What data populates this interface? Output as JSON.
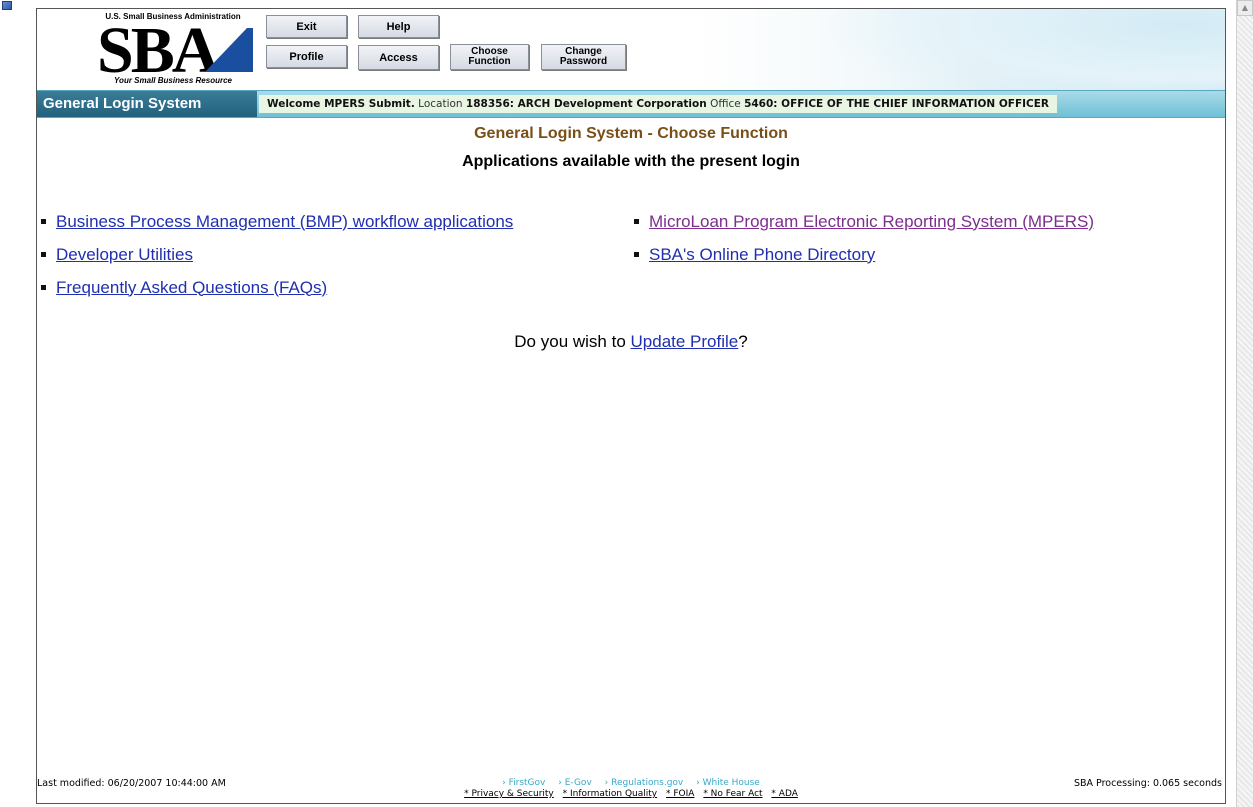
{
  "header": {
    "logo_top": "U.S. Small Business Administration",
    "logo_text": "SBA",
    "logo_tagline": "Your Small Business Resource",
    "buttons": {
      "exit": "Exit",
      "help": "Help",
      "profile": "Profile",
      "access": "Access",
      "choose_function_1": "Choose",
      "choose_function_2": "Function",
      "change_password_1": "Change",
      "change_password_2": "Password"
    }
  },
  "infobar": {
    "system_name": "General Login System",
    "welcome_label": "Welcome MPERS Submit.",
    "location_label": "Location",
    "location_value": "188356: ARCH Development Corporation",
    "office_label": "Office",
    "office_value": "5460: OFFICE OF THE CHIEF INFORMATION OFFICER"
  },
  "main": {
    "title": "General Login System - Choose Function",
    "subtitle": "Applications available with the present login",
    "apps_left": [
      "Business Process Management (BMP) workflow applications",
      "Developer Utilities",
      "Frequently Asked Questions (FAQs)"
    ],
    "apps_right": [
      "MicroLoan Program Electronic Reporting System (MPERS)",
      "SBA's Online Phone Directory"
    ],
    "update_prefix": "Do you wish to ",
    "update_link": "Update Profile",
    "update_suffix": "?"
  },
  "footer": {
    "last_modified": "Last modified: 06/20/2007 10:44:00 AM",
    "links": [
      "› FirstGov",
      "› E-Gov",
      "› Regulations.gov",
      "› White House"
    ],
    "policies": [
      "* Privacy & Security",
      "* Information Quality",
      "* FOIA",
      "* No Fear Act",
      "* ADA"
    ],
    "processing": "SBA Processing:  0.065 seconds"
  },
  "colors": {
    "title_brown": "#7a4f17",
    "link_blue": "#1f2fb0",
    "link_visited": "#7d2e8f",
    "bar_teal": "#6fc0d6",
    "system_tab": "#22617d"
  },
  "icons": {
    "corner": "ie-page-icon",
    "scroll_up": "scroll-up-arrow"
  }
}
